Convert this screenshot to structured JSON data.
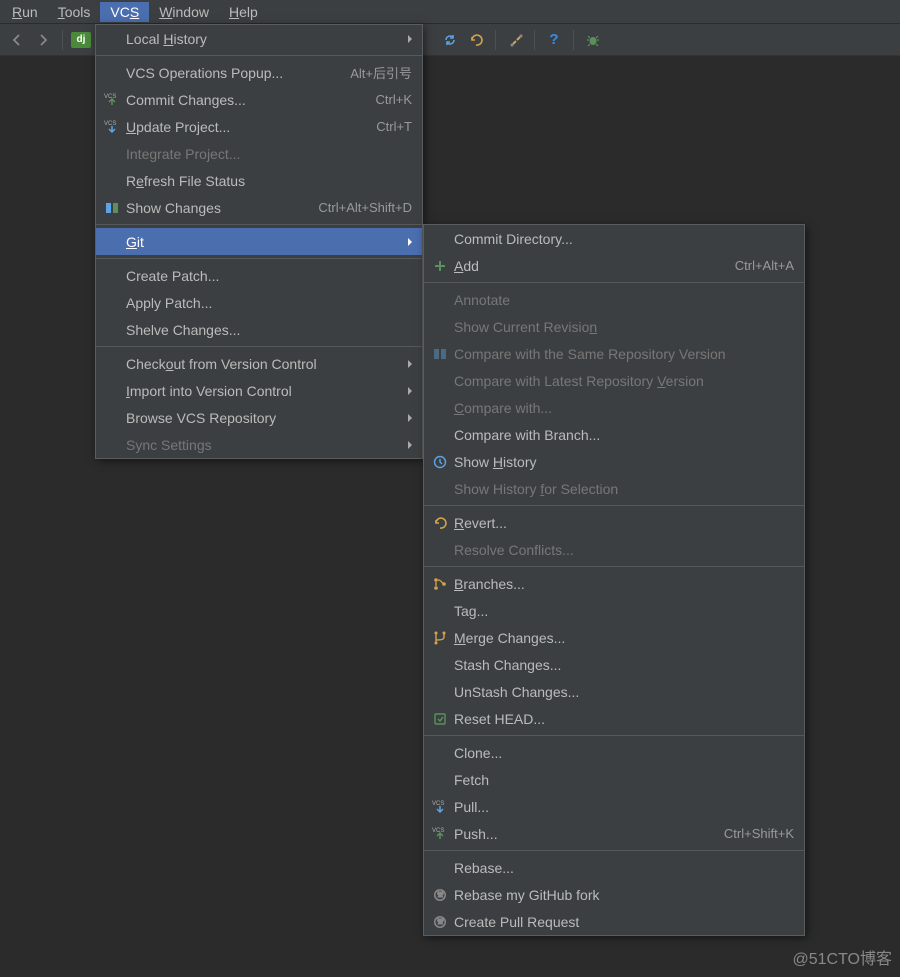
{
  "menubar": {
    "run": "Run",
    "tools": "Tools",
    "vcs": "VCS",
    "window": "Window",
    "help": "Help"
  },
  "toolbar": {
    "project_tag": "dj"
  },
  "vcs_menu": {
    "local_history": "Local History",
    "vcs_ops_popup": "VCS Operations Popup...",
    "vcs_ops_popup_sc": "Alt+后引号",
    "commit_changes": "Commit Changes...",
    "commit_changes_sc": "Ctrl+K",
    "update_project": "Update Project...",
    "update_project_sc": "Ctrl+T",
    "integrate_project": "Integrate Project...",
    "refresh_file_status": "Refresh File Status",
    "show_changes": "Show Changes",
    "show_changes_sc": "Ctrl+Alt+Shift+D",
    "git": "Git",
    "create_patch": "Create Patch...",
    "apply_patch": "Apply Patch...",
    "shelve_changes": "Shelve Changes...",
    "checkout_vc": "Checkout from Version Control",
    "import_vc": "Import into Version Control",
    "browse_vcs_repo": "Browse VCS Repository",
    "sync_settings": "Sync Settings"
  },
  "git_menu": {
    "commit_directory": "Commit Directory...",
    "add": "Add",
    "add_sc": "Ctrl+Alt+A",
    "annotate": "Annotate",
    "show_current_rev": "Show Current Revision",
    "cmp_same_repo": "Compare with the Same Repository Version",
    "cmp_latest_repo": "Compare with Latest Repository Version",
    "cmp_with": "Compare with...",
    "cmp_branch": "Compare with Branch...",
    "show_history": "Show History",
    "show_history_sel": "Show History for Selection",
    "revert": "Revert...",
    "resolve_conflicts": "Resolve Conflicts...",
    "branches": "Branches...",
    "tag": "Tag...",
    "merge_changes": "Merge Changes...",
    "stash_changes": "Stash Changes...",
    "unstash_changes": "UnStash Changes...",
    "reset_head": "Reset HEAD...",
    "clone": "Clone...",
    "fetch": "Fetch",
    "pull": "Pull...",
    "push": "Push...",
    "push_sc": "Ctrl+Shift+K",
    "rebase": "Rebase...",
    "rebase_github_fork": "Rebase my GitHub fork",
    "create_pr": "Create Pull Request"
  },
  "watermark": "@51CTO博客"
}
